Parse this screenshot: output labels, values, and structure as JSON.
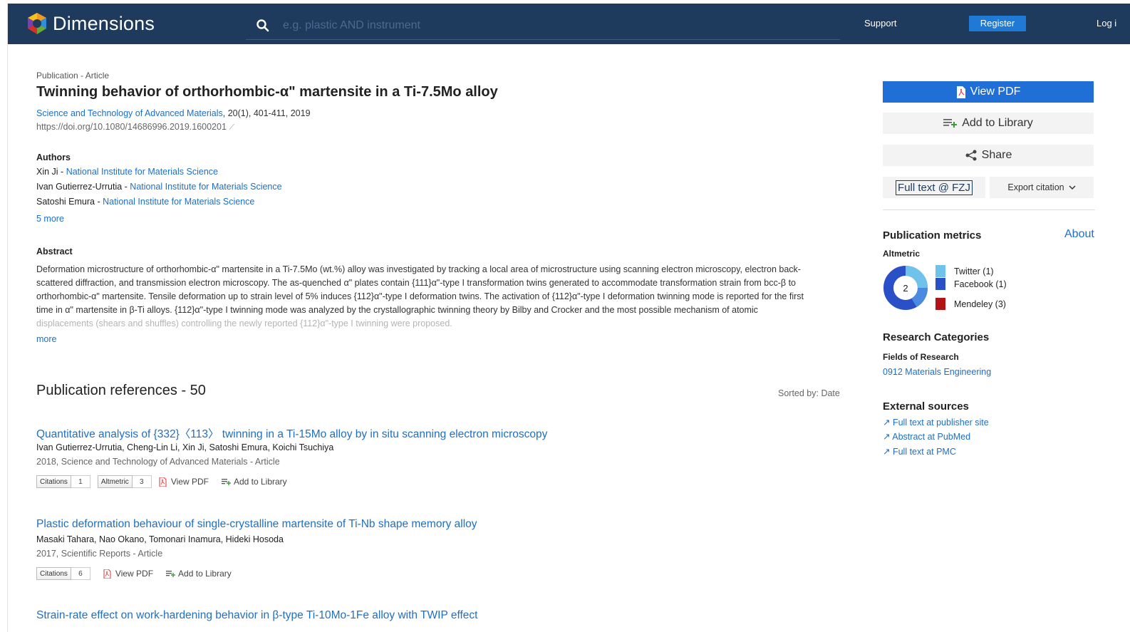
{
  "header": {
    "logo_text": "Dimensions",
    "search_placeholder": "e.g. plastic AND instrument",
    "support": "Support",
    "register": "Register",
    "login": "Log i"
  },
  "publication": {
    "type": "Publication - Article",
    "title": "Twinning behavior of orthorhombic-α\" martensite in a Ti-7.5Mo alloy",
    "journal": "Science and Technology of Advanced Materials",
    "journal_details": ", 20(1), 401-411, 2019",
    "doi": "https://doi.org/10.1080/14686996.2019.1600201"
  },
  "authors": {
    "heading": "Authors",
    "list": [
      {
        "name": "Xin Ji",
        "affiliation": "National Institute for Materials Science"
      },
      {
        "name": "Ivan Gutierrez-Urrutia",
        "affiliation": "National Institute for Materials Science"
      },
      {
        "name": "Satoshi Emura",
        "affiliation": "National Institute for Materials Science"
      }
    ],
    "more": "5 more"
  },
  "abstract": {
    "heading": "Abstract",
    "lines": [
      "Deformation microstructure of orthorhombic-α\" martensite in a Ti-7.5Mo (wt.%) alloy was investigated by tracking a local area of microstructure using scanning electron microscopy, electron back-",
      "scattered diffraction, and transmission electron microscopy. The as-quenched α\" plates contain {111}α\"-type I transformation twins generated to accommodate transformation strain from bcc-β to",
      "orthorhombic-α\" martensite. Tensile deformation up to strain level of 5% induces {112}α\"-type I deformation twins. The activation of {112}α\"-type I deformation twinning mode is reported for the first",
      "time in α\" martensite in β-Ti alloys. {112}α\"-type I twinning mode was analyzed by the crystallographic twinning theory by Bilby and Crocker and the most possible mechanism of atomic"
    ],
    "faded_line": "displacements (shears and shuffles) controlling the newly reported {112}α\"-type I twinning were proposed.",
    "more": "more"
  },
  "references": {
    "heading": "Publication references - 50",
    "sorted": "Sorted by: Date",
    "items": [
      {
        "title": "Quantitative analysis of {332}〈113〉 twinning in a Ti-15Mo alloy by in situ scanning electron microscopy",
        "authors": "Ivan Gutierrez-Urrutia, Cheng-Lin Li, Xin Ji, Satoshi Emura, Koichi Tsuchiya",
        "meta": "2018, Science and Technology of Advanced Materials - Article",
        "citations_label": "Citations",
        "citations": "1",
        "altmetric_label": "Altmetric",
        "altmetric": "3",
        "view_pdf": "View PDF",
        "add_library": "Add to Library"
      },
      {
        "title": "Plastic deformation behaviour of single-crystalline martensite of Ti-Nb shape memory alloy",
        "authors": "Masaki Tahara, Nao Okano, Tomonari Inamura, Hideki Hosoda",
        "meta": "2017, Scientific Reports - Article",
        "citations_label": "Citations",
        "citations": "6",
        "view_pdf": "View PDF",
        "add_library": "Add to Library"
      },
      {
        "title": "Strain-rate effect on work-hardening behavior in β-type Ti-10Mo-1Fe alloy with TWIP effect"
      }
    ]
  },
  "sidebar": {
    "view_pdf": "View PDF",
    "add_library": "Add to Library",
    "share": "Share",
    "full_text": "Full text @ FZJ",
    "export": "Export citation",
    "metrics_heading": "Publication metrics",
    "about": "About",
    "altmetric_label": "Altmetric",
    "altmetric_score": "2",
    "altmetric_legend": [
      {
        "label": "Twitter (1)",
        "color": "#6fc3ea"
      },
      {
        "label": "Facebook (1)",
        "color": "#2a50c8"
      },
      {
        "label": "Mendeley (3)",
        "color": "#b01414"
      }
    ],
    "categories_heading": "Research Categories",
    "fields_label": "Fields of Research",
    "field": "0912 Materials Engineering",
    "external_heading": "External sources",
    "external_links": [
      "Full text at publisher site",
      "Abstract at PubMed",
      "Full text at PMC"
    ]
  }
}
